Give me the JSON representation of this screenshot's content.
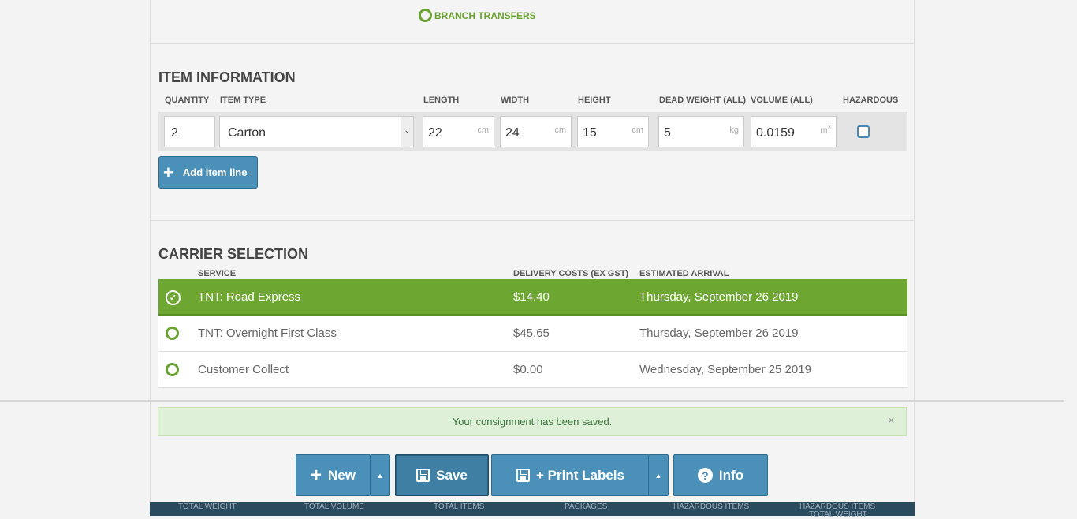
{
  "branch_transfers": "BRANCH TRANSFERS",
  "item_info": {
    "title": "ITEM INFORMATION",
    "headers": {
      "quantity": "QUANTITY",
      "item_type": "ITEM TYPE",
      "length": "LENGTH",
      "width": "WIDTH",
      "height": "HEIGHT",
      "dead_weight": "DEAD WEIGHT (ALL)",
      "volume": "VOLUME (ALL)",
      "hazardous": "HAZARDOUS"
    },
    "row": {
      "quantity": "2",
      "item_type": "Carton",
      "length": "22",
      "length_unit": "cm",
      "width": "24",
      "width_unit": "cm",
      "height": "15",
      "height_unit": "cm",
      "dead_weight": "5",
      "weight_unit": "kg",
      "volume": "0.0159",
      "volume_unit": "m",
      "volume_unit_sup": "3",
      "hazardous": false
    },
    "add_item_label": "Add item line"
  },
  "carrier": {
    "title": "CARRIER SELECTION",
    "headers": {
      "service": "SERVICE",
      "cost": "DELIVERY COSTS (EX GST)",
      "arrival": "ESTIMATED ARRIVAL"
    },
    "rows": [
      {
        "service": "TNT: Road Express",
        "cost": "$14.40",
        "arrival": "Thursday, September 26 2019",
        "selected": true
      },
      {
        "service": "TNT: Overnight First Class",
        "cost": "$45.65",
        "arrival": "Thursday, September 26 2019",
        "selected": false
      },
      {
        "service": "Customer Collect",
        "cost": "$0.00",
        "arrival": "Wednesday, September 25 2019",
        "selected": false
      }
    ]
  },
  "alert": {
    "message": "Your consignment has been saved.",
    "close": "×"
  },
  "actions": {
    "new_label": "New",
    "save_label": "Save",
    "print_label": "+ Print Labels",
    "info_label": "Info"
  },
  "footer": {
    "labels": [
      "TOTAL WEIGHT",
      "TOTAL VOLUME",
      "TOTAL ITEMS",
      "PACKAGES",
      "HAZARDOUS ITEMS",
      "HAZARDOUS ITEMS",
      "TOTAL WEIGHT"
    ]
  },
  "colors": {
    "green": "#6da630",
    "blue": "#4a90b8",
    "navy": "#2a4a5e"
  }
}
